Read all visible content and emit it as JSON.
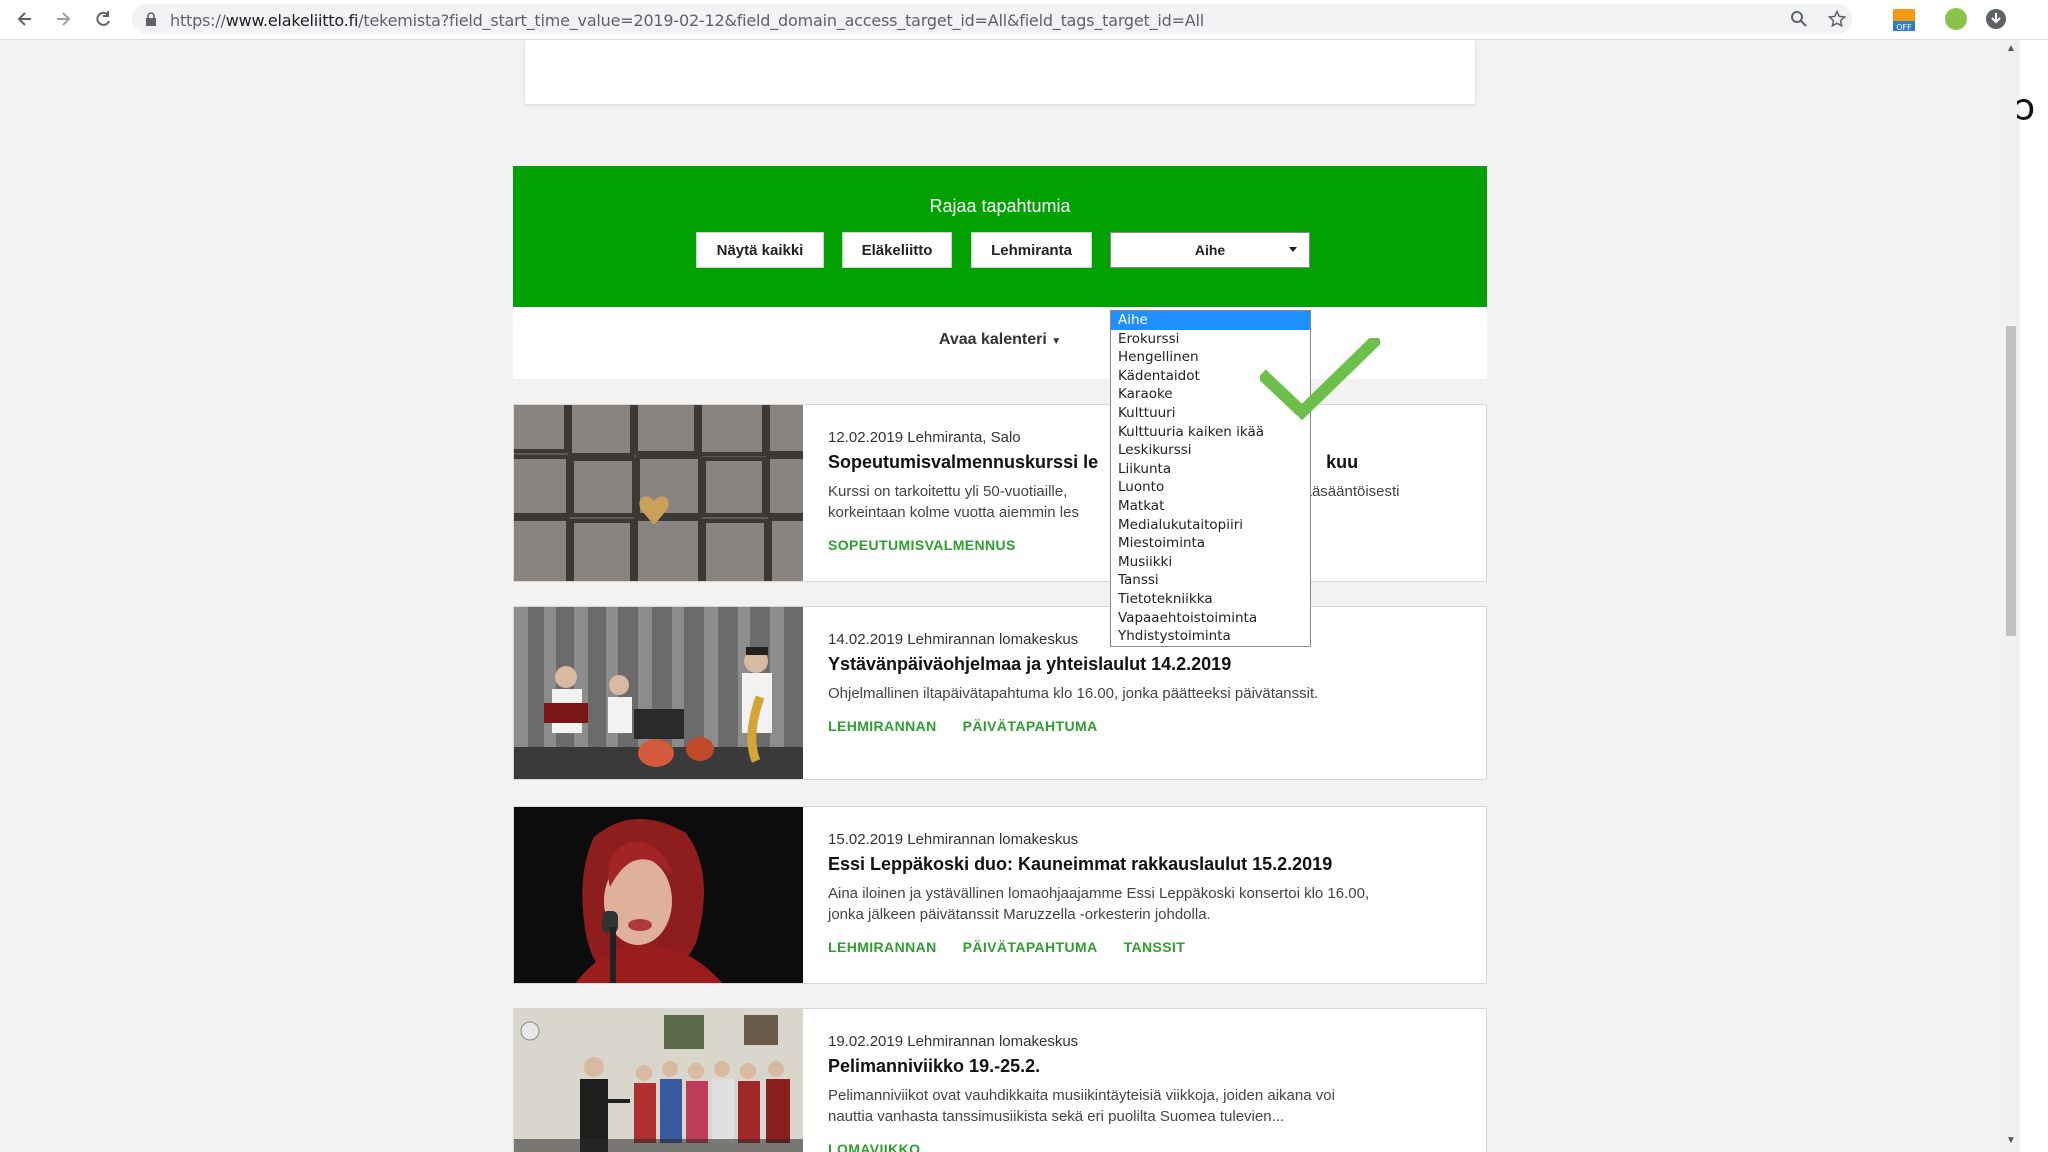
{
  "browser": {
    "url_prefix": "https://",
    "url_host": "www.elakeliitto.fi",
    "url_rest": "/tekemista?field_start_time_value=2019-02-12&field_domain_access_target_id=All&field_tags_target_id=All",
    "ext_badge": "OFF"
  },
  "filter": {
    "title": "Rajaa tapahtumia",
    "buttons": [
      "Näytä kaikki",
      "Eläkeliitto",
      "Lehmiranta"
    ],
    "select_value": "Aihe",
    "options": [
      "Aihe",
      "Erokurssi",
      "Hengellinen",
      "Kädentaidot",
      "Karaoke",
      "Kulttuuri",
      "Kulttuuria kaiken ikää",
      "Leskikurssi",
      "Liikunta",
      "Luonto",
      "Matkat",
      "Medialukutaitopiiri",
      "Miestoiminta",
      "Musiikki",
      "Tanssi",
      "Tietotekniikka",
      "Vapaaehtoistoiminta",
      "Yhdistystoiminta"
    ]
  },
  "calendar": {
    "toggle_label": "Avaa kalenteri"
  },
  "events": [
    {
      "meta": "12.02.2019 Lehmiranta, Salo",
      "title": "Sopeutumisvalmennuskurssi le",
      "title_tail": "kuu",
      "desc_line1": "Kurssi on tarkoitettu yli 50-vuotiaille,",
      "desc_line1_tail": "pääsääntöisesti",
      "desc_line2": "korkeintaan kolme vuotta aiemmin les",
      "tags": [
        "SOPEUTUMISVALMENNUS"
      ]
    },
    {
      "meta": "14.02.2019 Lehmirannan lomakeskus",
      "title": "Ystävänpäiväohjelmaa ja yhteislaulut 14.2.2019",
      "desc": "Ohjelmallinen iltapäivätapahtuma klo 16.00, jonka päätteeksi päivätanssit.",
      "tags": [
        "LEHMIRANNAN",
        "PÄIVÄTAPAHTUMA"
      ]
    },
    {
      "meta": "15.02.2019 Lehmirannan lomakeskus",
      "title": "Essi Leppäkoski duo: Kauneimmat rakkauslaulut 15.2.2019",
      "desc_line1": "Aina iloinen ja ystävällinen lomaohjaajamme Essi Leppäkoski konsertoi klo 16.00,",
      "desc_line2": "jonka jälkeen päivätanssit Maruzzella -orkesterin johdolla.",
      "tags": [
        "LEHMIRANNAN",
        "PÄIVÄTAPAHTUMA",
        "TANSSIT"
      ]
    },
    {
      "meta": "19.02.2019 Lehmirannan lomakeskus",
      "title": "Pelimanniviikko 19.-25.2.",
      "desc_line1": "Pelimanniviikot ovat vauhdikkaita musiikintäyteisiä viikkoja, joiden aikana voi",
      "desc_line2": "nauttia vanhasta tanssimusiikista sekä eri puolilta Suomea tulevien...",
      "tags": [
        "LOMAVIIKKO"
      ]
    }
  ]
}
